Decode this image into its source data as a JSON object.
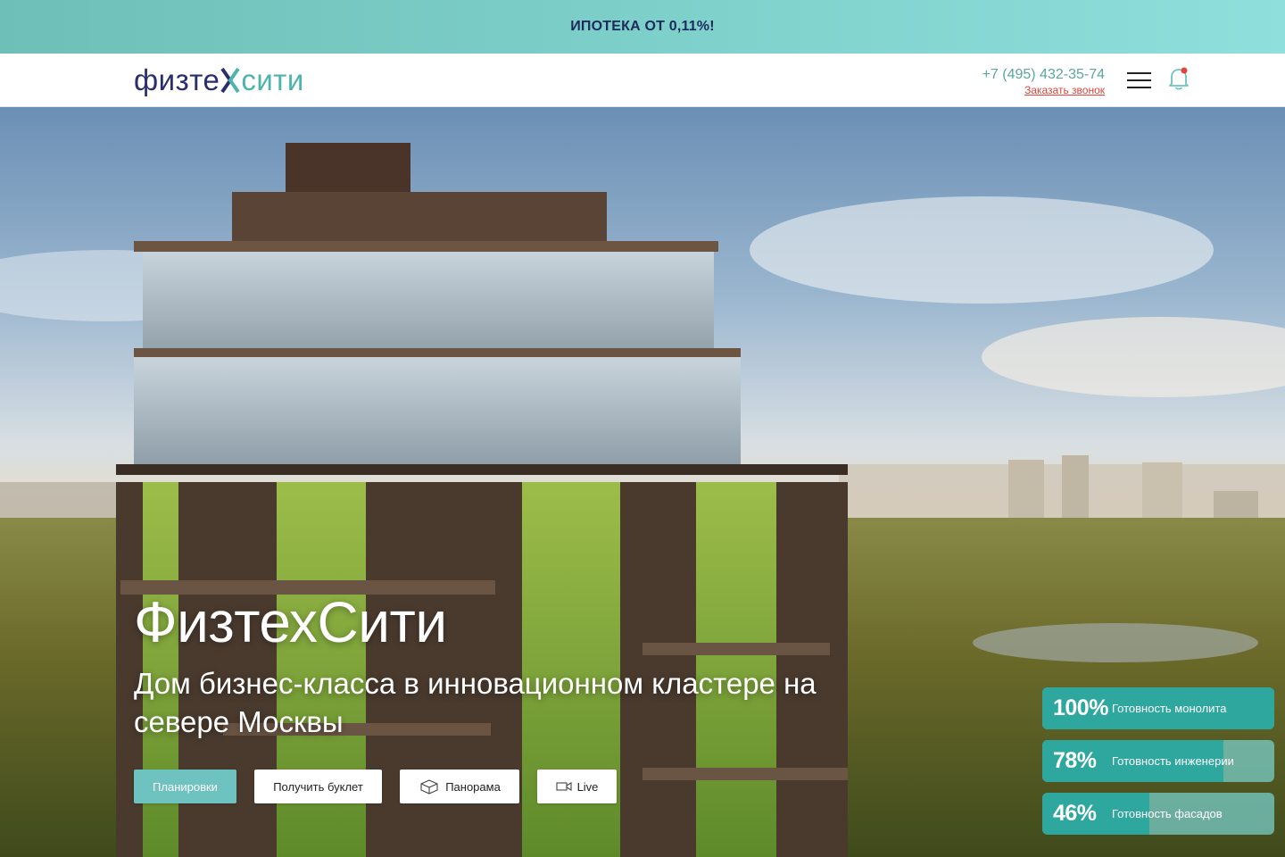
{
  "promo": {
    "text": "ИПОТЕКА ОТ 0,11%!"
  },
  "header": {
    "logo": {
      "part_a": "физте",
      "part_b": "сити"
    },
    "phone": "+7 (495) 432-35-74",
    "callback_label": "Заказать звонок",
    "icons": {
      "menu": "hamburger-menu-icon",
      "bell": "bell-icon"
    },
    "notification_color": "#e2433c"
  },
  "hero": {
    "title": "ФизтехСити",
    "subtitle": "Дом бизнес-класса в инновационном кластере на севере Москвы",
    "buttons": {
      "plans": "Планировки",
      "booklet": "Получить буклет",
      "panorama": "Панорама",
      "live": "Live"
    },
    "button_icons": {
      "panorama": "cube-3d-icon",
      "live": "video-camera-icon"
    }
  },
  "progress": [
    {
      "percent": "100%",
      "value": 1.0,
      "label": "Готовность монолита"
    },
    {
      "percent": "78%",
      "value": 0.78,
      "label": "Готовность инженерии"
    },
    {
      "percent": "46%",
      "value": 0.46,
      "label": "Готовность фасадов"
    }
  ],
  "colors": {
    "brand_dark": "#2a2d6e",
    "brand_teal": "#4db3ad",
    "accent_button": "#6ec3c0",
    "progress_fill": "#2ea79f"
  }
}
